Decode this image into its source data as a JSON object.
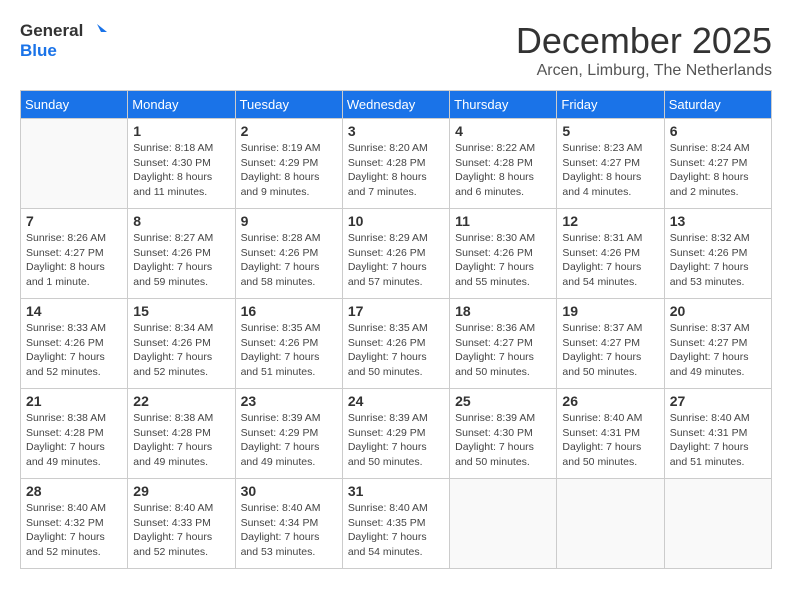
{
  "logo": {
    "line1": "General",
    "line2": "Blue"
  },
  "title": "December 2025",
  "subtitle": "Arcen, Limburg, The Netherlands",
  "weekdays": [
    "Sunday",
    "Monday",
    "Tuesday",
    "Wednesday",
    "Thursday",
    "Friday",
    "Saturday"
  ],
  "weeks": [
    [
      {
        "day": "",
        "info": ""
      },
      {
        "day": "1",
        "info": "Sunrise: 8:18 AM\nSunset: 4:30 PM\nDaylight: 8 hours\nand 11 minutes."
      },
      {
        "day": "2",
        "info": "Sunrise: 8:19 AM\nSunset: 4:29 PM\nDaylight: 8 hours\nand 9 minutes."
      },
      {
        "day": "3",
        "info": "Sunrise: 8:20 AM\nSunset: 4:28 PM\nDaylight: 8 hours\nand 7 minutes."
      },
      {
        "day": "4",
        "info": "Sunrise: 8:22 AM\nSunset: 4:28 PM\nDaylight: 8 hours\nand 6 minutes."
      },
      {
        "day": "5",
        "info": "Sunrise: 8:23 AM\nSunset: 4:27 PM\nDaylight: 8 hours\nand 4 minutes."
      },
      {
        "day": "6",
        "info": "Sunrise: 8:24 AM\nSunset: 4:27 PM\nDaylight: 8 hours\nand 2 minutes."
      }
    ],
    [
      {
        "day": "7",
        "info": "Sunrise: 8:26 AM\nSunset: 4:27 PM\nDaylight: 8 hours\nand 1 minute."
      },
      {
        "day": "8",
        "info": "Sunrise: 8:27 AM\nSunset: 4:26 PM\nDaylight: 7 hours\nand 59 minutes."
      },
      {
        "day": "9",
        "info": "Sunrise: 8:28 AM\nSunset: 4:26 PM\nDaylight: 7 hours\nand 58 minutes."
      },
      {
        "day": "10",
        "info": "Sunrise: 8:29 AM\nSunset: 4:26 PM\nDaylight: 7 hours\nand 57 minutes."
      },
      {
        "day": "11",
        "info": "Sunrise: 8:30 AM\nSunset: 4:26 PM\nDaylight: 7 hours\nand 55 minutes."
      },
      {
        "day": "12",
        "info": "Sunrise: 8:31 AM\nSunset: 4:26 PM\nDaylight: 7 hours\nand 54 minutes."
      },
      {
        "day": "13",
        "info": "Sunrise: 8:32 AM\nSunset: 4:26 PM\nDaylight: 7 hours\nand 53 minutes."
      }
    ],
    [
      {
        "day": "14",
        "info": "Sunrise: 8:33 AM\nSunset: 4:26 PM\nDaylight: 7 hours\nand 52 minutes."
      },
      {
        "day": "15",
        "info": "Sunrise: 8:34 AM\nSunset: 4:26 PM\nDaylight: 7 hours\nand 52 minutes."
      },
      {
        "day": "16",
        "info": "Sunrise: 8:35 AM\nSunset: 4:26 PM\nDaylight: 7 hours\nand 51 minutes."
      },
      {
        "day": "17",
        "info": "Sunrise: 8:35 AM\nSunset: 4:26 PM\nDaylight: 7 hours\nand 50 minutes."
      },
      {
        "day": "18",
        "info": "Sunrise: 8:36 AM\nSunset: 4:27 PM\nDaylight: 7 hours\nand 50 minutes."
      },
      {
        "day": "19",
        "info": "Sunrise: 8:37 AM\nSunset: 4:27 PM\nDaylight: 7 hours\nand 50 minutes."
      },
      {
        "day": "20",
        "info": "Sunrise: 8:37 AM\nSunset: 4:27 PM\nDaylight: 7 hours\nand 49 minutes."
      }
    ],
    [
      {
        "day": "21",
        "info": "Sunrise: 8:38 AM\nSunset: 4:28 PM\nDaylight: 7 hours\nand 49 minutes."
      },
      {
        "day": "22",
        "info": "Sunrise: 8:38 AM\nSunset: 4:28 PM\nDaylight: 7 hours\nand 49 minutes."
      },
      {
        "day": "23",
        "info": "Sunrise: 8:39 AM\nSunset: 4:29 PM\nDaylight: 7 hours\nand 49 minutes."
      },
      {
        "day": "24",
        "info": "Sunrise: 8:39 AM\nSunset: 4:29 PM\nDaylight: 7 hours\nand 50 minutes."
      },
      {
        "day": "25",
        "info": "Sunrise: 8:39 AM\nSunset: 4:30 PM\nDaylight: 7 hours\nand 50 minutes."
      },
      {
        "day": "26",
        "info": "Sunrise: 8:40 AM\nSunset: 4:31 PM\nDaylight: 7 hours\nand 50 minutes."
      },
      {
        "day": "27",
        "info": "Sunrise: 8:40 AM\nSunset: 4:31 PM\nDaylight: 7 hours\nand 51 minutes."
      }
    ],
    [
      {
        "day": "28",
        "info": "Sunrise: 8:40 AM\nSunset: 4:32 PM\nDaylight: 7 hours\nand 52 minutes."
      },
      {
        "day": "29",
        "info": "Sunrise: 8:40 AM\nSunset: 4:33 PM\nDaylight: 7 hours\nand 52 minutes."
      },
      {
        "day": "30",
        "info": "Sunrise: 8:40 AM\nSunset: 4:34 PM\nDaylight: 7 hours\nand 53 minutes."
      },
      {
        "day": "31",
        "info": "Sunrise: 8:40 AM\nSunset: 4:35 PM\nDaylight: 7 hours\nand 54 minutes."
      },
      {
        "day": "",
        "info": ""
      },
      {
        "day": "",
        "info": ""
      },
      {
        "day": "",
        "info": ""
      }
    ]
  ]
}
